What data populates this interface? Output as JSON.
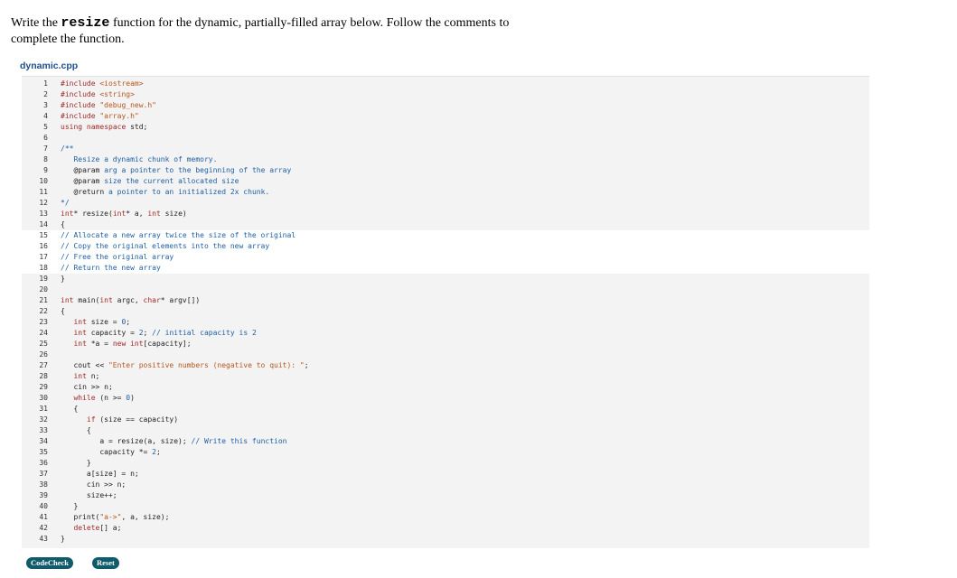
{
  "prompt": {
    "before": "Write the ",
    "code_word": "resize",
    "after": " function for the dynamic, partially-filled array below. Follow the comments to complete the function."
  },
  "file": {
    "name": "dynamic.cpp"
  },
  "code_lines": [
    {
      "n": "1",
      "text": "#include <iostream>"
    },
    {
      "n": "2",
      "text": "#include <string>"
    },
    {
      "n": "3",
      "text": "#include \"debug_new.h\""
    },
    {
      "n": "4",
      "text": "#include \"array.h\""
    },
    {
      "n": "5",
      "text": "using namespace std;"
    },
    {
      "n": "6",
      "text": ""
    },
    {
      "n": "7",
      "text": "/**"
    },
    {
      "n": "8",
      "text": "   Resize a dynamic chunk of memory."
    },
    {
      "n": "9",
      "text": "   @param arg a pointer to the beginning of the array"
    },
    {
      "n": "10",
      "text": "   @param size the current allocated size"
    },
    {
      "n": "11",
      "text": "   @return a pointer to an initialized 2x chunk."
    },
    {
      "n": "12",
      "text": "*/"
    },
    {
      "n": "13",
      "text": "int* resize(int* a, int size)"
    },
    {
      "n": "14",
      "text": "{"
    },
    {
      "n": "15",
      "text": "// Allocate a new array twice the size of the original"
    },
    {
      "n": "16",
      "text": "// Copy the original elements into the new array"
    },
    {
      "n": "17",
      "text": "// Free the original array"
    },
    {
      "n": "18",
      "text": "// Return the new array"
    },
    {
      "n": "19",
      "text": "}"
    },
    {
      "n": "20",
      "text": ""
    },
    {
      "n": "21",
      "text": "int main(int argc, char* argv[])"
    },
    {
      "n": "22",
      "text": "{"
    },
    {
      "n": "23",
      "text": "   int size = 0;"
    },
    {
      "n": "24",
      "text": "   int capacity = 2; // initial capacity is 2"
    },
    {
      "n": "25",
      "text": "   int *a = new int[capacity];"
    },
    {
      "n": "26",
      "text": ""
    },
    {
      "n": "27",
      "text": "   cout << \"Enter positive numbers (negative to quit): \";"
    },
    {
      "n": "28",
      "text": "   int n;"
    },
    {
      "n": "29",
      "text": "   cin >> n;"
    },
    {
      "n": "30",
      "text": "   while (n >= 0)"
    },
    {
      "n": "31",
      "text": "   {"
    },
    {
      "n": "32",
      "text": "      if (size == capacity)"
    },
    {
      "n": "33",
      "text": "      {"
    },
    {
      "n": "34",
      "text": "         a = resize(a, size); // Write this function"
    },
    {
      "n": "35",
      "text": "         capacity *= 2;"
    },
    {
      "n": "36",
      "text": "      }"
    },
    {
      "n": "37",
      "text": "      a[size] = n;"
    },
    {
      "n": "38",
      "text": "      cin >> n;"
    },
    {
      "n": "39",
      "text": "      size++;"
    },
    {
      "n": "40",
      "text": "   }"
    },
    {
      "n": "41",
      "text": "   print(\"a->\", a, size);"
    },
    {
      "n": "42",
      "text": "   delete[] a;"
    },
    {
      "n": "43",
      "text": "}"
    }
  ],
  "highlighted_lines": [
    "15",
    "16",
    "17",
    "18"
  ],
  "buttons": {
    "codecheck": "CodeCheck",
    "reset": "Reset"
  },
  "colors": {
    "button_bg": "#0f5a6b",
    "filename": "#1f4e8c",
    "editor_bg": "#f3f3f3",
    "keyword": "#a32828",
    "string": "#b8561c",
    "comment": "#1c5fa6"
  }
}
